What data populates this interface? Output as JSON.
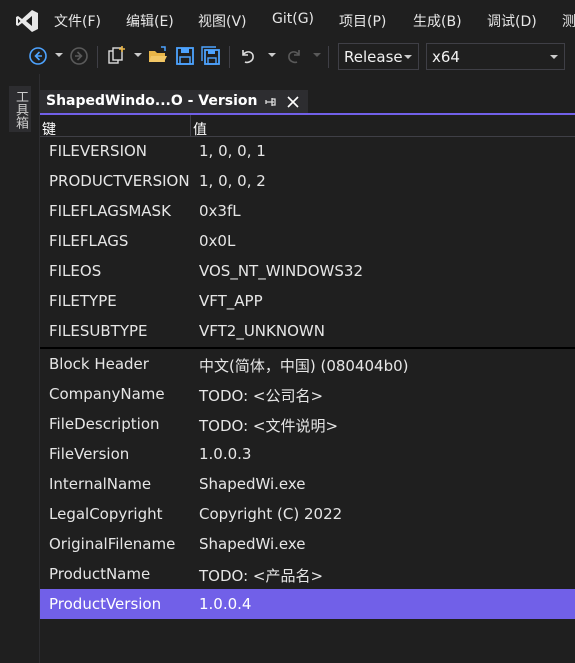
{
  "menu": {
    "items": [
      "文件(F)",
      "编辑(E)",
      "视图(V)",
      "Git(G)",
      "项目(P)",
      "生成(B)",
      "调试(D)",
      "测"
    ]
  },
  "toolbar": {
    "configuration": "Release",
    "platform": "x64",
    "icons": [
      "back-icon",
      "forward-icon",
      "new-project-icon",
      "open-folder-icon",
      "save-icon",
      "save-all-icon",
      "undo-icon",
      "redo-icon"
    ]
  },
  "toolbox": {
    "label": "工具箱"
  },
  "document": {
    "tab_title": "ShapedWindo...O - Version"
  },
  "grid": {
    "key_header": "键",
    "value_header": "值",
    "fixed_info": [
      {
        "key": "FILEVERSION",
        "value": "1, 0, 0, 1"
      },
      {
        "key": "PRODUCTVERSION",
        "value": "1, 0, 0, 2"
      },
      {
        "key": "FILEFLAGSMASK",
        "value": "0x3fL"
      },
      {
        "key": "FILEFLAGS",
        "value": "0x0L"
      },
      {
        "key": "FILEOS",
        "value": "VOS_NT_WINDOWS32"
      },
      {
        "key": "FILETYPE",
        "value": "VFT_APP"
      },
      {
        "key": "FILESUBTYPE",
        "value": "VFT2_UNKNOWN"
      }
    ],
    "string_info": [
      {
        "key": "Block Header",
        "value": "中文(简体，中国) (080404b0)"
      },
      {
        "key": "CompanyName",
        "value": "TODO: <公司名>"
      },
      {
        "key": "FileDescription",
        "value": "TODO: <文件说明>"
      },
      {
        "key": "FileVersion",
        "value": "1.0.0.3"
      },
      {
        "key": "InternalName",
        "value": "ShapedWi.exe"
      },
      {
        "key": "LegalCopyright",
        "value": "Copyright (C) 2022"
      },
      {
        "key": "OriginalFilename",
        "value": "ShapedWi.exe"
      },
      {
        "key": "ProductName",
        "value": "TODO: <产品名>"
      },
      {
        "key": "ProductVersion",
        "value": "1.0.0.4"
      }
    ]
  },
  "colors": {
    "accent": "#7160e8",
    "background": "#1f1f1f"
  }
}
